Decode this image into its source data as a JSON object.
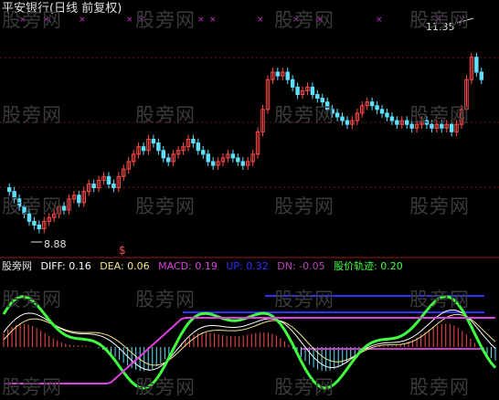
{
  "title": "平安银行(日线 前复权)",
  "watermark": "股旁网",
  "colors": {
    "background": "#000000",
    "up": "#ff4a4a",
    "down": "#5fe0ff",
    "grid": "#7a1010",
    "diff": "#ffffff",
    "dea": "#f5e68a",
    "macd": "#e040e0",
    "up_line": "#3030ff",
    "dn_line": "#c040c0",
    "track": "#40ff40"
  },
  "indicator_row": {
    "name": "股旁网",
    "diff": "DIFF: 0.16",
    "dea": "DEA: 0.06",
    "macd": "MACD: 0.19",
    "up": "UP: 0.32",
    "dn": "DN: -0.05",
    "track": "股价轨迹: 0.20"
  },
  "chart_data": [
    {
      "type": "candlestick",
      "title": "平安银行(日线 前复权)",
      "annotations": [
        {
          "label": "11.35",
          "kind": "high"
        },
        {
          "label": "8.88",
          "kind": "low"
        }
      ],
      "grid": true,
      "ylim": [
        8.6,
        11.6
      ],
      "closes": [
        9.4,
        9.3,
        9.2,
        9.1,
        9.0,
        8.95,
        8.9,
        9.0,
        9.05,
        9.1,
        9.2,
        9.15,
        9.3,
        9.35,
        9.25,
        9.4,
        9.5,
        9.45,
        9.55,
        9.6,
        9.5,
        9.45,
        9.6,
        9.7,
        9.8,
        9.9,
        10.0,
        9.95,
        10.1,
        10.05,
        9.95,
        9.85,
        9.8,
        9.9,
        9.95,
        10.0,
        10.1,
        10.05,
        9.95,
        9.9,
        9.8,
        9.75,
        9.8,
        9.85,
        9.9,
        9.85,
        9.8,
        9.75,
        9.8,
        9.9,
        10.2,
        10.5,
        10.9,
        11.0,
        10.95,
        11.0,
        10.9,
        10.8,
        10.7,
        10.75,
        10.8,
        10.7,
        10.65,
        10.6,
        10.5,
        10.45,
        10.4,
        10.35,
        10.3,
        10.35,
        10.45,
        10.55,
        10.6,
        10.55,
        10.5,
        10.45,
        10.4,
        10.35,
        10.3,
        10.35,
        10.3,
        10.25,
        10.3,
        10.35,
        10.3,
        10.25,
        10.3,
        10.25,
        10.3,
        10.2,
        10.3,
        10.5,
        10.9,
        11.2,
        11.0,
        10.9
      ]
    },
    {
      "type": "line",
      "series": [
        {
          "name": "DIFF",
          "value": 0.16
        },
        {
          "name": "DEA",
          "value": 0.06
        },
        {
          "name": "MACD",
          "value": 0.19
        },
        {
          "name": "UP",
          "value": 0.32
        },
        {
          "name": "DN",
          "value": -0.05
        },
        {
          "name": "股价轨迹",
          "value": 0.2
        }
      ]
    }
  ]
}
